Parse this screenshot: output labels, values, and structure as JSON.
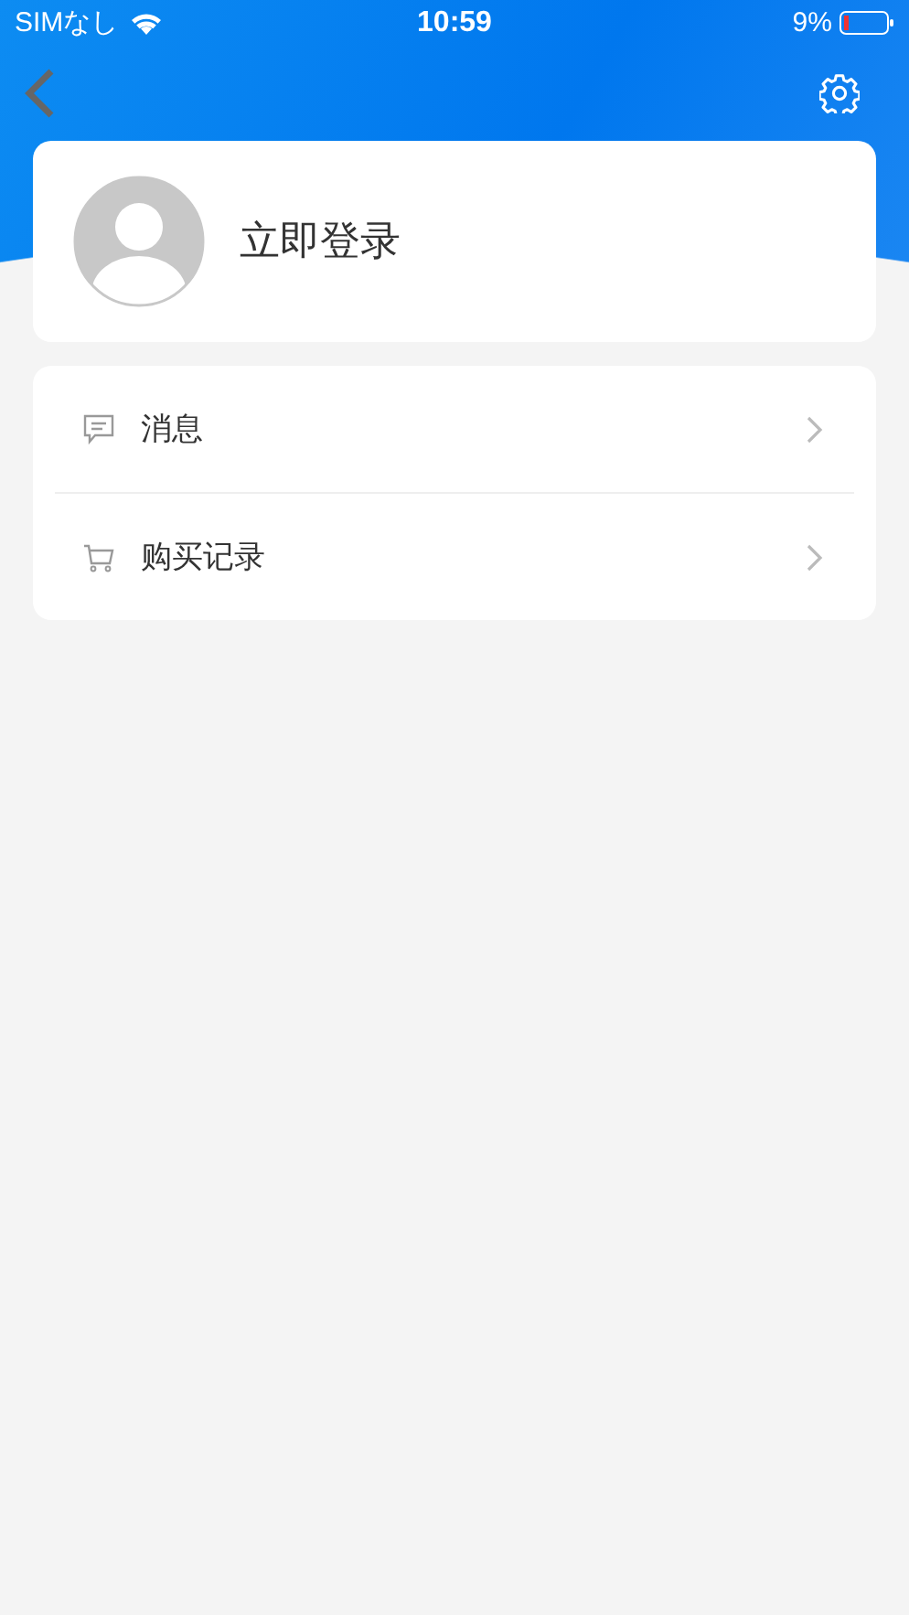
{
  "status_bar": {
    "carrier": "SIMなし",
    "time": "10:59",
    "battery": "9%"
  },
  "profile": {
    "login_label": "立即登录"
  },
  "menu": [
    {
      "kind": "message",
      "label": "消息"
    },
    {
      "kind": "cart",
      "label": "购买记录"
    }
  ]
}
